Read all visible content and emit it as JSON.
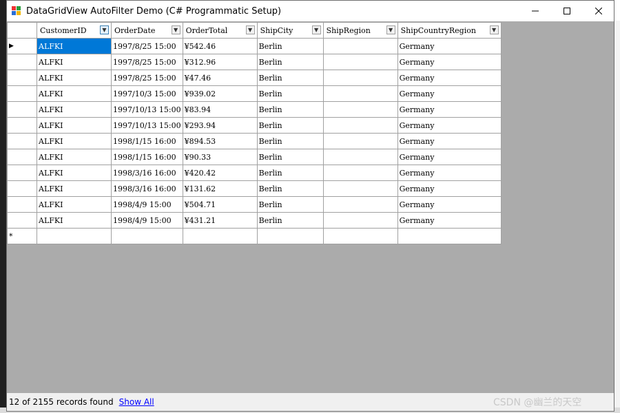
{
  "window": {
    "title": "DataGridView AutoFilter Demo (C# Programmatic Setup)"
  },
  "grid": {
    "columns": [
      "CustomerID",
      "OrderDate",
      "OrderTotal",
      "ShipCity",
      "ShipRegion",
      "ShipCountryRegion"
    ],
    "rows": [
      [
        "ALFKI",
        "1997/8/25 15:00",
        "¥542.46",
        "Berlin",
        "",
        "Germany"
      ],
      [
        "ALFKI",
        "1997/8/25 15:00",
        "¥312.96",
        "Berlin",
        "",
        "Germany"
      ],
      [
        "ALFKI",
        "1997/8/25 15:00",
        "¥47.46",
        "Berlin",
        "",
        "Germany"
      ],
      [
        "ALFKI",
        "1997/10/3 15:00",
        "¥939.02",
        "Berlin",
        "",
        "Germany"
      ],
      [
        "ALFKI",
        "1997/10/13 15:00",
        "¥83.94",
        "Berlin",
        "",
        "Germany"
      ],
      [
        "ALFKI",
        "1997/10/13 15:00",
        "¥293.94",
        "Berlin",
        "",
        "Germany"
      ],
      [
        "ALFKI",
        "1998/1/15 16:00",
        "¥894.53",
        "Berlin",
        "",
        "Germany"
      ],
      [
        "ALFKI",
        "1998/1/15 16:00",
        "¥90.33",
        "Berlin",
        "",
        "Germany"
      ],
      [
        "ALFKI",
        "1998/3/16 16:00",
        "¥420.42",
        "Berlin",
        "",
        "Germany"
      ],
      [
        "ALFKI",
        "1998/3/16 16:00",
        "¥131.62",
        "Berlin",
        "",
        "Germany"
      ],
      [
        "ALFKI",
        "1998/4/9 15:00",
        "¥504.71",
        "Berlin",
        "",
        "Germany"
      ],
      [
        "ALFKI",
        "1998/4/9 15:00",
        "¥431.21",
        "Berlin",
        "",
        "Germany"
      ]
    ],
    "current_row_marker": "▶",
    "new_row_marker": "*"
  },
  "status": {
    "records_text": "12 of 2155 records found",
    "show_all_label": "Show All"
  },
  "watermark": "CSDN @幽兰的天空",
  "colors": {
    "selection": "#0078d7",
    "grid_background": "#ababab",
    "link": "#0000ff"
  }
}
